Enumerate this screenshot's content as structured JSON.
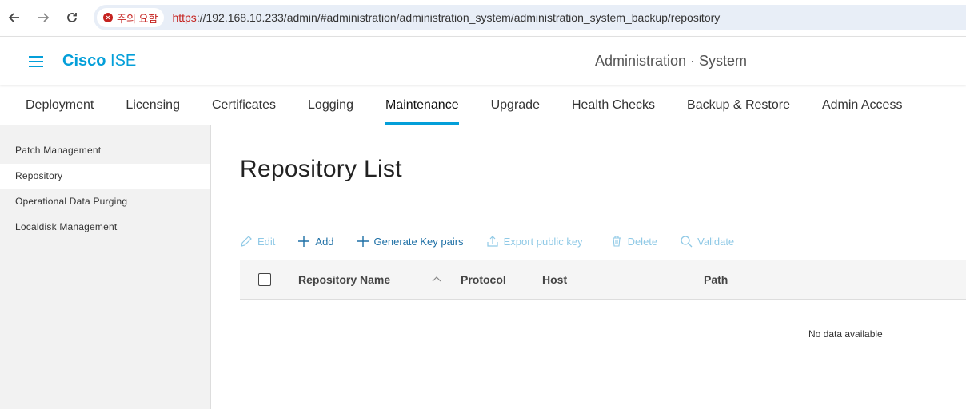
{
  "browser": {
    "security_warning": "주의 요함",
    "url_scheme": "https",
    "url_rest": "://192.168.10.233/admin/#administration/administration_system/administration_system_backup/repository"
  },
  "header": {
    "brand_bold": "Cisco",
    "brand_light": "ISE",
    "context": "Administration · System",
    "accent_color": "#049fd9"
  },
  "tabs": [
    {
      "label": "Deployment",
      "active": false
    },
    {
      "label": "Licensing",
      "active": false
    },
    {
      "label": "Certificates",
      "active": false
    },
    {
      "label": "Logging",
      "active": false
    },
    {
      "label": "Maintenance",
      "active": true
    },
    {
      "label": "Upgrade",
      "active": false
    },
    {
      "label": "Health Checks",
      "active": false
    },
    {
      "label": "Backup & Restore",
      "active": false
    },
    {
      "label": "Admin Access",
      "active": false
    }
  ],
  "sidebar": {
    "items": [
      {
        "label": "Patch Management",
        "active": false
      },
      {
        "label": "Repository",
        "active": true
      },
      {
        "label": "Operational Data Purging",
        "active": false
      },
      {
        "label": "Localdisk Management",
        "active": false
      }
    ]
  },
  "main": {
    "title": "Repository List",
    "toolbar": {
      "edit": "Edit",
      "add": "Add",
      "generate_key_pairs": "Generate Key pairs",
      "export_public_key": "Export public key",
      "delete": "Delete",
      "validate": "Validate"
    },
    "table": {
      "columns": [
        "Repository Name",
        "Protocol",
        "Host",
        "Path"
      ],
      "empty_message": "No data available"
    }
  }
}
